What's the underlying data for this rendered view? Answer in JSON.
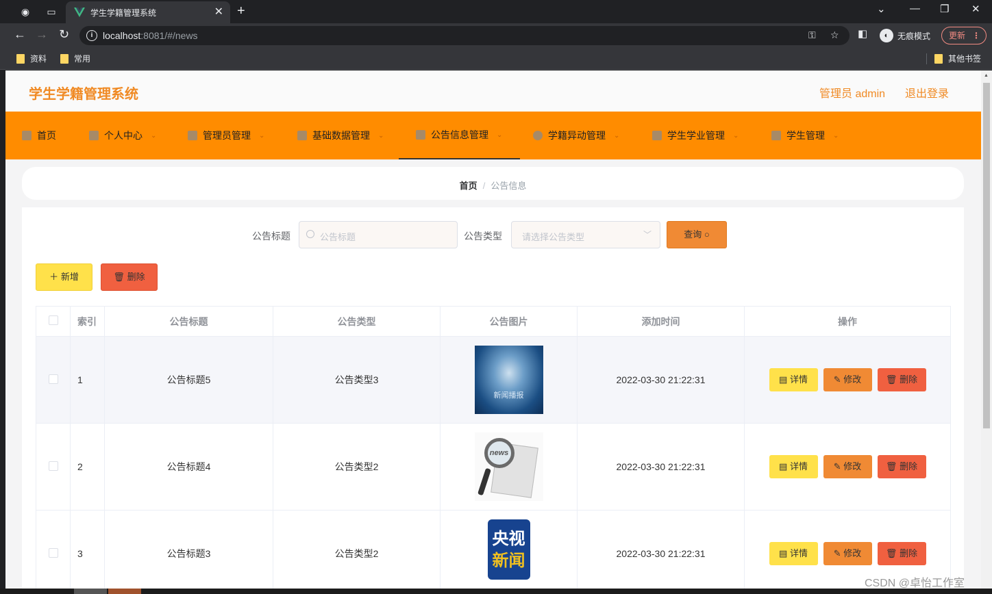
{
  "browser": {
    "tab_title": "学生学籍管理系统",
    "url_host": "localhost",
    "url_rest": ":8081/#/news",
    "incognito_label": "无痕模式",
    "update_label": "更新",
    "bookmarks": [
      "资料",
      "常用"
    ],
    "other_bookmarks": "其他书签"
  },
  "header": {
    "title": "学生学籍管理系统",
    "admin": "管理员 admin",
    "logout": "退出登录"
  },
  "nav": {
    "items": [
      {
        "label": "首页"
      },
      {
        "label": "个人中心"
      },
      {
        "label": "管理员管理"
      },
      {
        "label": "基础数据管理"
      },
      {
        "label": "公告信息管理"
      },
      {
        "label": "学籍异动管理"
      },
      {
        "label": "学生学业管理"
      },
      {
        "label": "学生管理"
      }
    ],
    "active": "公告信息管理"
  },
  "breadcrumb": {
    "home": "首页",
    "sep": "/",
    "current": "公告信息"
  },
  "search": {
    "title_label": "公告标题",
    "title_placeholder": "公告标题",
    "type_label": "公告类型",
    "type_placeholder": "请选择公告类型",
    "query_button": "查询"
  },
  "actions": {
    "add": "新增",
    "delete": "删除"
  },
  "table": {
    "headers": [
      "索引",
      "公告标题",
      "公告类型",
      "公告图片",
      "添加时间",
      "操作"
    ],
    "rows": [
      {
        "index": "1",
        "title": "公告标题5",
        "type": "公告类型3",
        "image_caption": "新闻播报",
        "time": "2022-03-30 21:22:31"
      },
      {
        "index": "2",
        "title": "公告标题4",
        "type": "公告类型2",
        "image_caption": "news",
        "time": "2022-03-30 21:22:31"
      },
      {
        "index": "3",
        "title": "公告标题3",
        "type": "公告类型2",
        "image_caption_1": "央视",
        "image_caption_2": "新闻",
        "time": "2022-03-30 21:22:31"
      }
    ],
    "op_detail": "详情",
    "op_edit": "修改",
    "op_delete": "删除"
  },
  "watermark": "CSDN @卓怡工作室",
  "colors": {
    "accent": "#ff8c00",
    "title": "#f08a24",
    "add": "#ffe14a",
    "delete": "#f06040",
    "edit": "#f08a34"
  }
}
